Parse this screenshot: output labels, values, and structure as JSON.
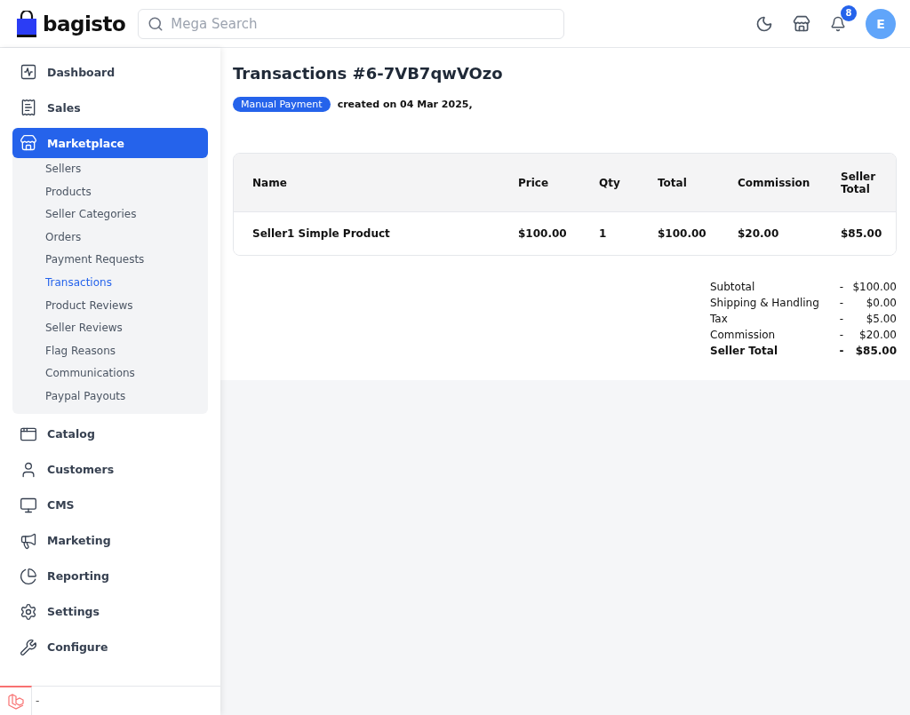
{
  "header": {
    "logo": "bagisto",
    "search": {
      "placeholder": "Mega Search"
    },
    "notifications": {
      "count": "8"
    },
    "avatar": "E"
  },
  "sidebar": {
    "items": [
      {
        "label": "Dashboard",
        "selected": false
      },
      {
        "label": "Sales",
        "selected": false
      },
      {
        "label": "Marketplace",
        "selected": true,
        "expanded": true,
        "children": [
          {
            "label": "Sellers",
            "selected": false
          },
          {
            "label": "Products",
            "selected": false
          },
          {
            "label": "Seller Categories",
            "selected": false
          },
          {
            "label": "Orders",
            "selected": false
          },
          {
            "label": "Payment Requests",
            "selected": false
          },
          {
            "label": "Transactions",
            "selected": true
          },
          {
            "label": "Product Reviews",
            "selected": false
          },
          {
            "label": "Seller Reviews",
            "selected": false
          },
          {
            "label": "Flag Reasons",
            "selected": false
          },
          {
            "label": "Communications",
            "selected": false
          },
          {
            "label": "Paypal Payouts",
            "selected": false
          }
        ]
      },
      {
        "label": "Catalog",
        "selected": false
      },
      {
        "label": "Customers",
        "selected": false
      },
      {
        "label": "CMS",
        "selected": false
      },
      {
        "label": "Marketing",
        "selected": false
      },
      {
        "label": "Reporting",
        "selected": false
      },
      {
        "label": "Settings",
        "selected": false
      },
      {
        "label": "Configure",
        "selected": false
      }
    ]
  },
  "debugbar": {
    "text": "-"
  },
  "page": {
    "title": "Transactions #6-7VB7qwVOzo",
    "badge": "Manual Payment",
    "created": "created on 04 Mar 2025,"
  },
  "table": {
    "columns": [
      "Name",
      "Price",
      "Qty",
      "Total",
      "Commission",
      "Seller Total"
    ],
    "rows": [
      [
        "Seller1 Simple Product",
        "$100.00",
        "1",
        "$100.00",
        "$20.00",
        "$85.00"
      ]
    ]
  },
  "summary": [
    {
      "label": "Subtotal",
      "separator": "-",
      "value": "$100.00",
      "bold": false
    },
    {
      "label": "Shipping & Handling",
      "separator": "-",
      "value": "$0.00",
      "bold": false
    },
    {
      "label": "Tax",
      "separator": "-",
      "value": "$5.00",
      "bold": false
    },
    {
      "label": "Commission",
      "separator": "-",
      "value": "$20.00",
      "bold": false
    },
    {
      "label": "Seller Total",
      "separator": "-",
      "value": "$85.00",
      "bold": true
    }
  ]
}
